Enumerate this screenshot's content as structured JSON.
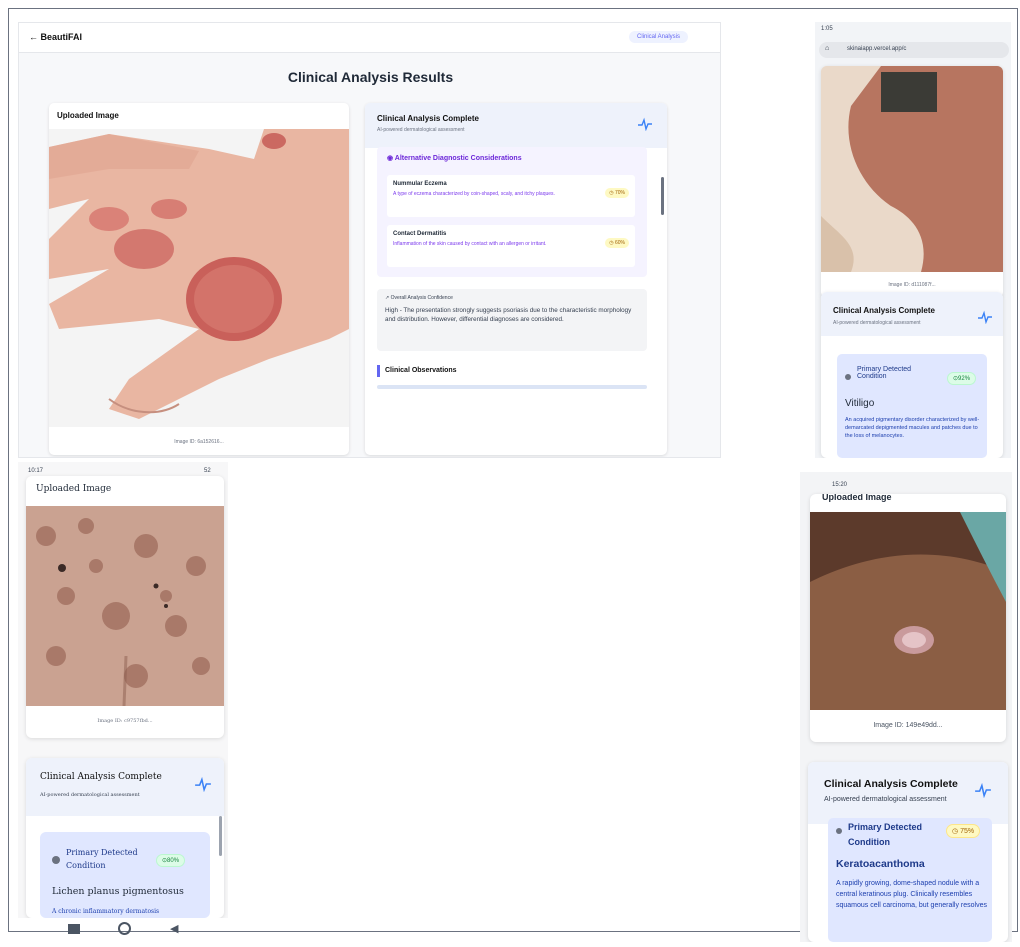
{
  "desktop": {
    "brand": "← BeautiFAI",
    "pill": "Clinical Analysis",
    "title": "Clinical Analysis Results",
    "uploaded_title": "Uploaded Image",
    "image_id": "Image ID: 6a152616...",
    "analysis_title": "Clinical Analysis Complete",
    "analysis_subtitle": "AI-powered dermatological assessment",
    "alt_title": "Alternative Diagnostic Considerations",
    "alternatives": [
      {
        "name": "Nummular Eczema",
        "desc": "A type of eczema characterized by coin-shaped, scaly, and itchy plaques.",
        "pct": "70%"
      },
      {
        "name": "Contact Dermatitis",
        "desc": "Inflammation of the skin caused by contact with an allergen or irritant.",
        "pct": "60%"
      }
    ],
    "confidence_label": "Overall Analysis Confidence",
    "confidence_text": "High - The presentation strongly suggests psoriasis due to the characteristic morphology and distribution. However, differential diagnoses are considered.",
    "observations": "Clinical Observations"
  },
  "phone_tr": {
    "time": "1:05",
    "url": "skinaiapp.vercel.app/c",
    "image_id": "Image ID: d111087f...",
    "analysis_title": "Clinical Analysis Complete",
    "analysis_subtitle": "AI-powered dermatological assessment",
    "primary_label": "Primary Detected Condition",
    "pct": "92%",
    "condition": "Vitiligo",
    "desc": "An acquired pigmentary disorder characterized by well-demarcated depigmented macules and patches due to the loss of melanocytes."
  },
  "phone_bl": {
    "time": "10:17",
    "battery": "52",
    "uploaded_title": "Uploaded Image",
    "image_id": "Image ID: c9757fbd...",
    "analysis_title": "Clinical Analysis Complete",
    "analysis_subtitle": "AI-powered dermatological assessment",
    "primary_label": "Primary Detected Condition",
    "pct": "80%",
    "condition": "Lichen planus pigmentosus",
    "desc": "A chronic inflammatory dermatosis"
  },
  "phone_br": {
    "time": "15:20",
    "uploaded_title": "Uploaded Image",
    "image_id": "Image ID: 149e49dd...",
    "analysis_title": "Clinical Analysis Complete",
    "analysis_subtitle": "AI-powered dermatological assessment",
    "primary_label": "Primary Detected Condition",
    "pct": "75%",
    "condition": "Keratoacanthoma",
    "desc": "A rapidly growing, dome-shaped nodule with a central keratinous plug. Clinically resembles squamous cell carcinoma, but generally resolves"
  }
}
